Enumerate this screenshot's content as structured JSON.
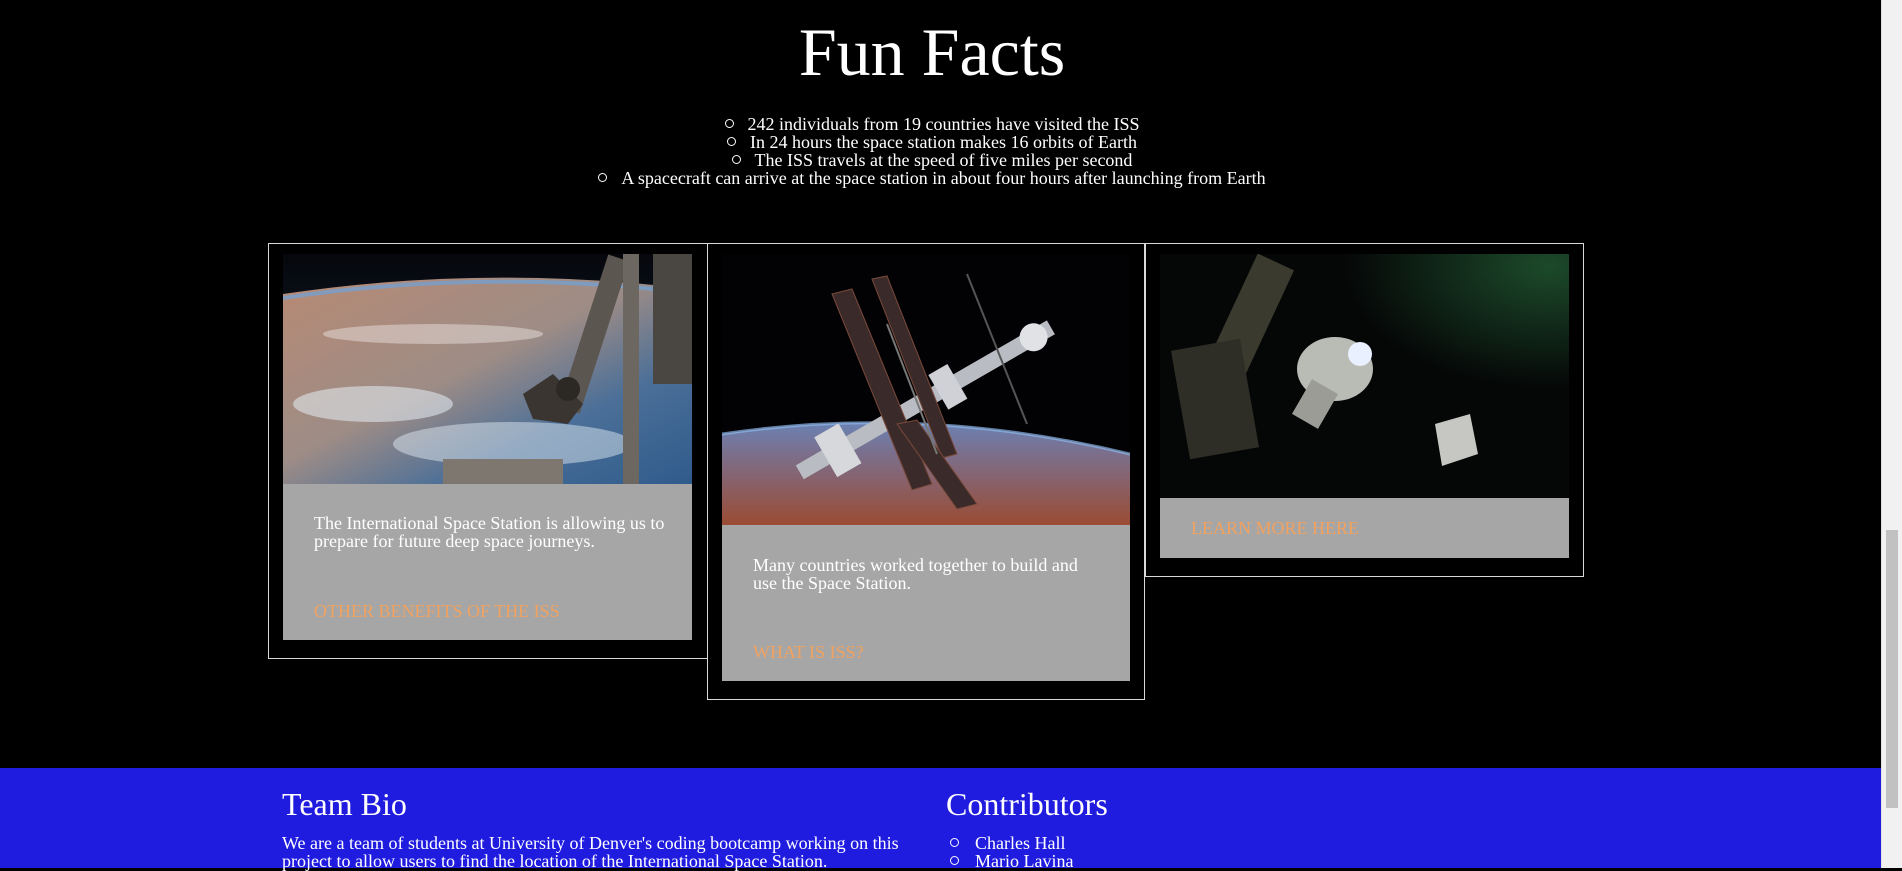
{
  "fun_facts": {
    "title": "Fun Facts",
    "items": [
      "242 individuals from 19 countries have visited the ISS",
      "In 24 hours the space station makes 16 orbits of Earth",
      "The ISS travels at the speed of five miles per second",
      "A spacecraft can arrive at the space station in about four hours after launching from Earth"
    ]
  },
  "cards": [
    {
      "image": "iss-robotic-arm-over-earth-photo",
      "text": "The International Space Station is allowing us to prepare for future deep space journeys.",
      "link": "OTHER BENEFITS OF THE ISS"
    },
    {
      "image": "iss-in-orbit-photo",
      "text": "Many countries worked together to build and use the Space Station.",
      "link": "WHAT IS ISS?"
    },
    {
      "image": "astronaut-spacewalk-photo",
      "text": "",
      "link": "LEARN MORE HERE"
    }
  ],
  "footer": {
    "team_bio": {
      "heading": "Team Bio",
      "text": "We are a team of students at University of Denver's coding bootcamp working on this project to allow users to find the location of the International Space Station."
    },
    "contributors": {
      "heading": "Contributors",
      "names": [
        "Charles Hall",
        "Mario Lavina"
      ]
    }
  },
  "colors": {
    "background": "#000000",
    "footer": "#1f1bdf",
    "card_panel": "#a6a6a6",
    "link": "#f2a25e"
  }
}
